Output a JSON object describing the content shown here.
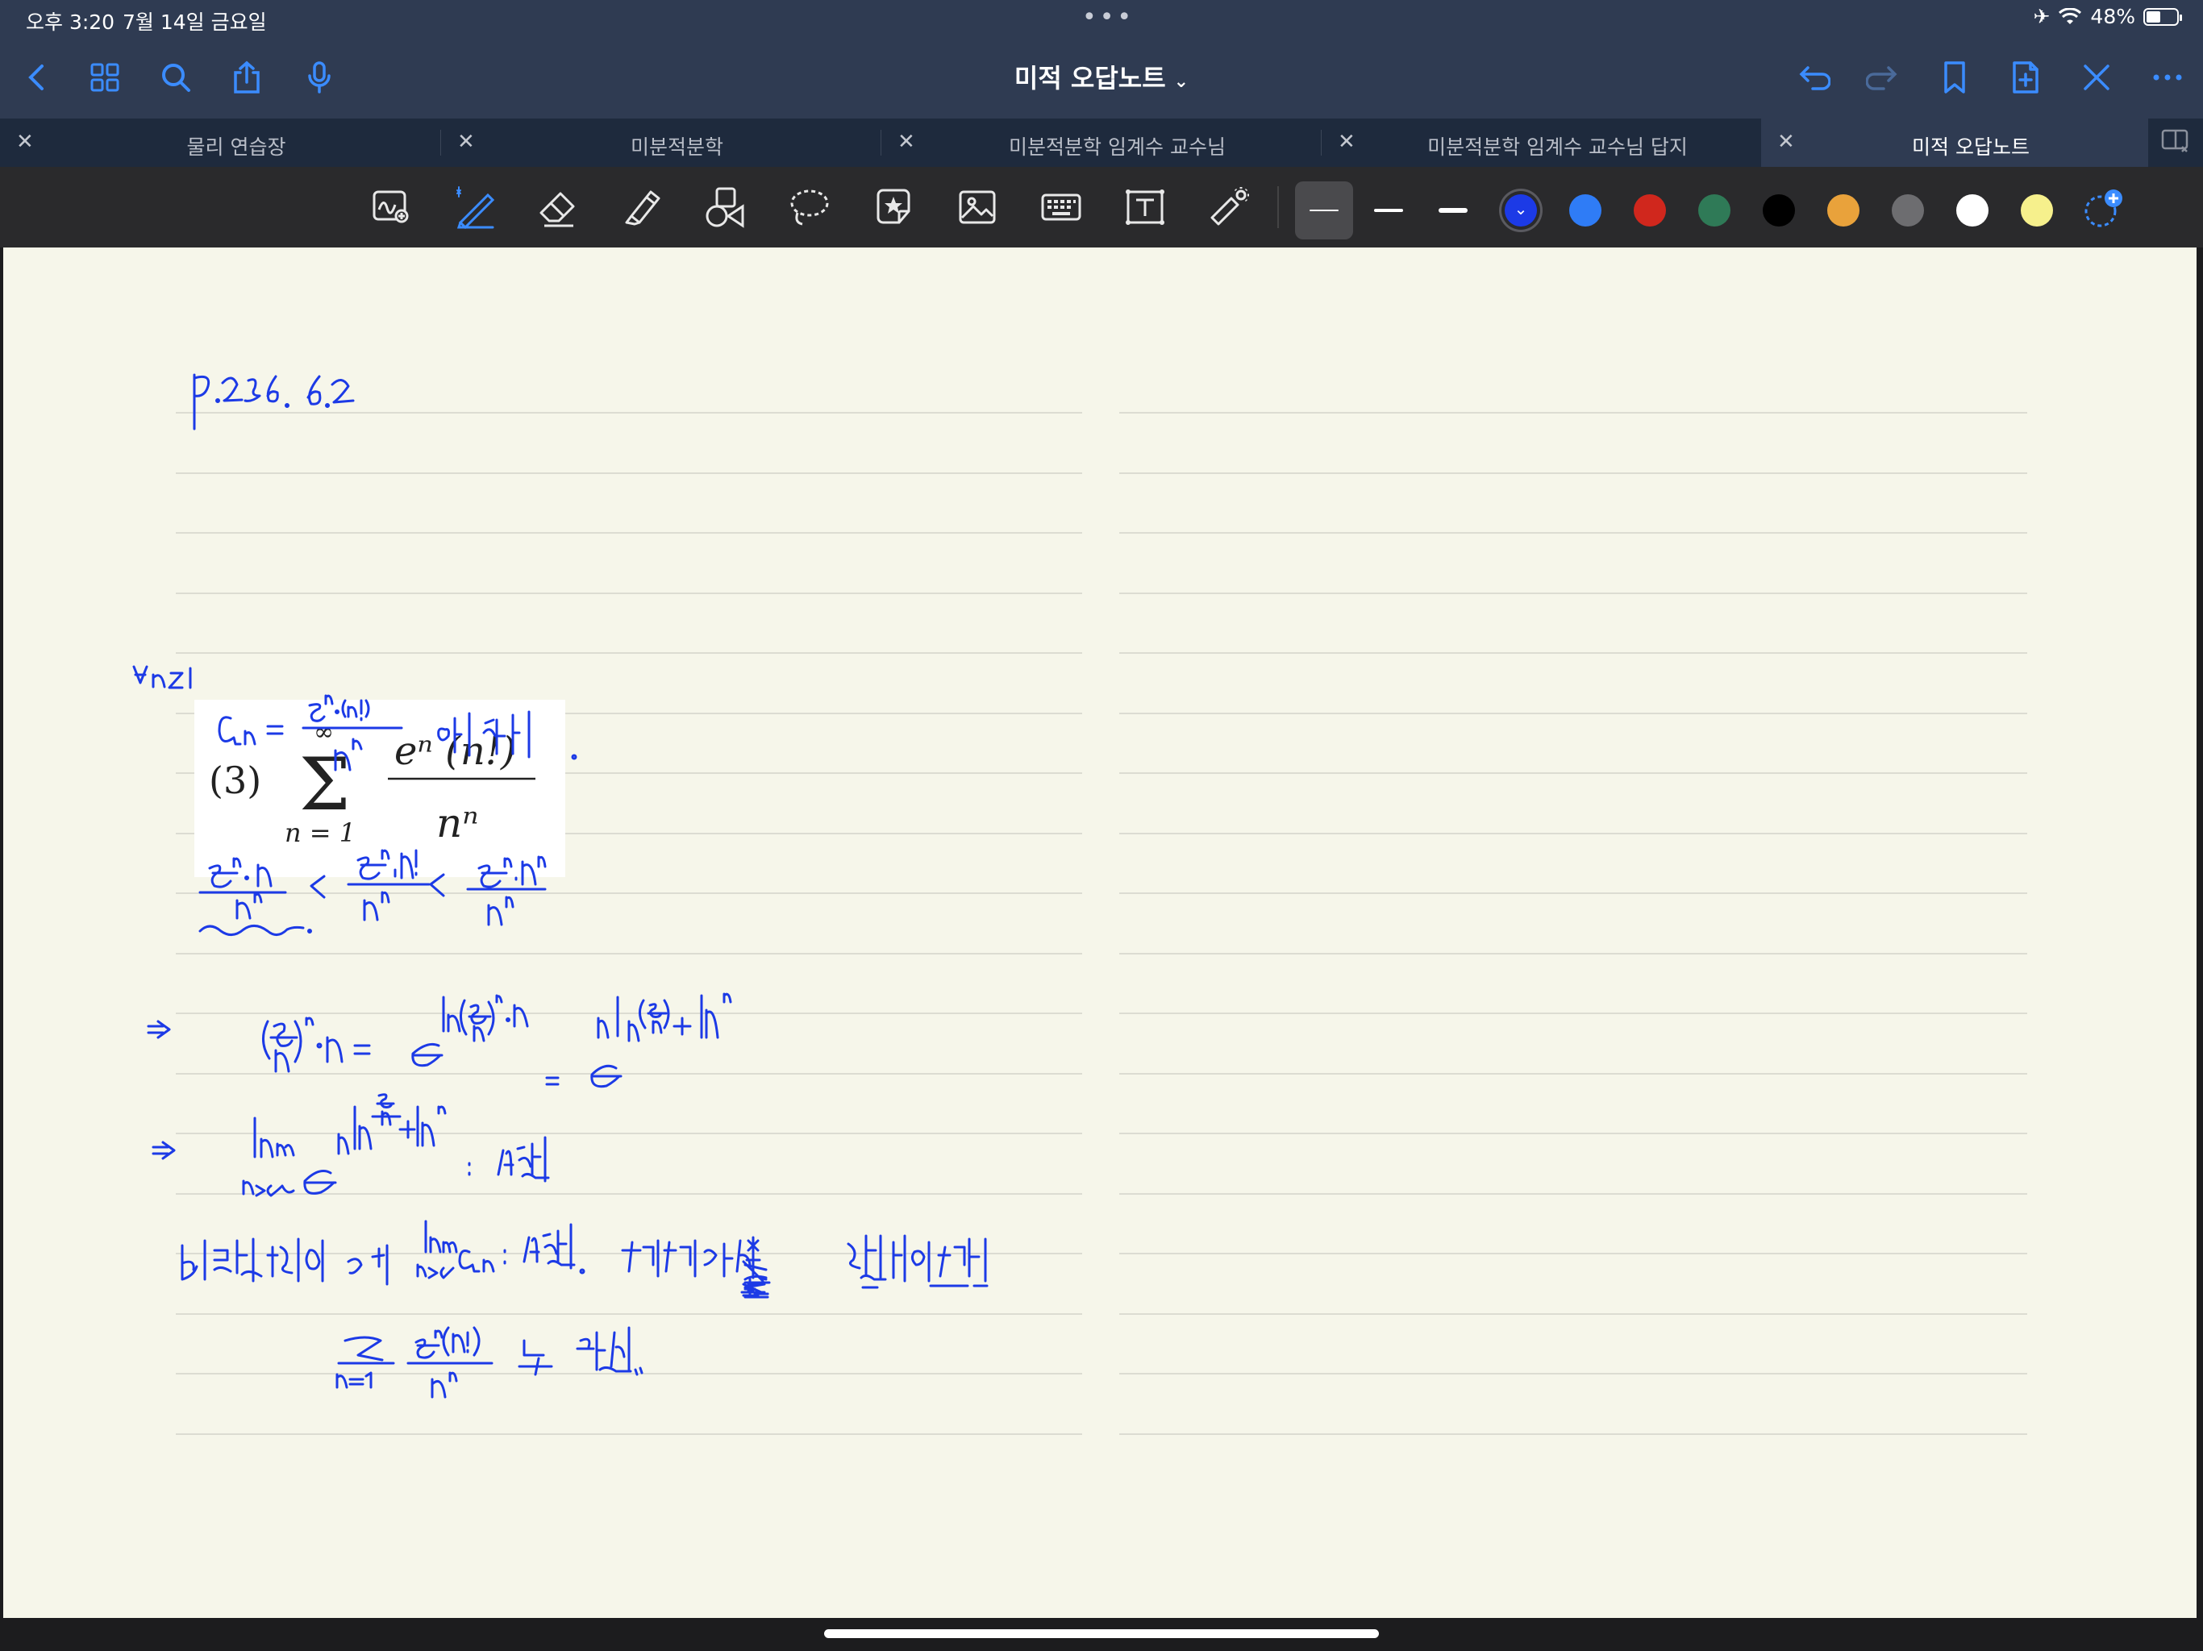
{
  "status": {
    "time": "오후 3:20",
    "date": "7월 14일 금요일",
    "battery": "48%",
    "battery_level": 0.48
  },
  "nav": {
    "title": "미적 오답노트"
  },
  "tabs": [
    {
      "label": "물리 연습장",
      "active": false
    },
    {
      "label": "미분적분학",
      "active": false
    },
    {
      "label": "미분적분학 임계수 교수님",
      "active": false
    },
    {
      "label": "미분적분학 임계수 교수님 답지",
      "active": false
    },
    {
      "label": "미적 오답노트",
      "active": true
    }
  ],
  "toolbar": {
    "tools": [
      "zoom-window-icon",
      "pen-icon",
      "eraser-icon",
      "highlighter-icon",
      "shapes-icon",
      "lasso-icon",
      "sticker-icon",
      "image-icon",
      "keyboard-icon",
      "text-box-icon",
      "laser-pointer-icon"
    ],
    "selected_tool": "pen-icon",
    "colors": [
      "#1c3ae6",
      "#2f7cf6",
      "#d0271d",
      "#2f7a57",
      "#000000",
      "#e9a23b",
      "#6d6d70",
      "#ffffff",
      "#f6f08c"
    ],
    "selected_color": "#1c3ae6"
  },
  "page": {
    "handwritten_lines": [
      "p.236. 6.2",
      "∀n≥1",
      "aₙ = eⁿ·(n!) / nⁿ 이라 하자.",
      "eⁿ·n / nⁿ < eⁿ·n! / nⁿ < eⁿ·nⁿ / nⁿ",
      "⇒ (e/n)ⁿ·n = e^(ln(e/n)ⁿ·n) = e^(n ln(e/n) + ln n)",
      "⇒ lim(n→∞) e^(n ln(e/n) + ln n) : 발산",
      "비교판정법에 의해 lim aₙ : 발산. 따라서 일반항 판정법에 의해",
      "Σ(n=1) eⁿ(n!) / nⁿ 는 발산."
    ],
    "printed_problem": {
      "label": "(3)",
      "sum_upper": "∞",
      "sum_lower": "n = 1",
      "numerator": "eⁿ (n!)",
      "denominator": "nⁿ"
    }
  }
}
